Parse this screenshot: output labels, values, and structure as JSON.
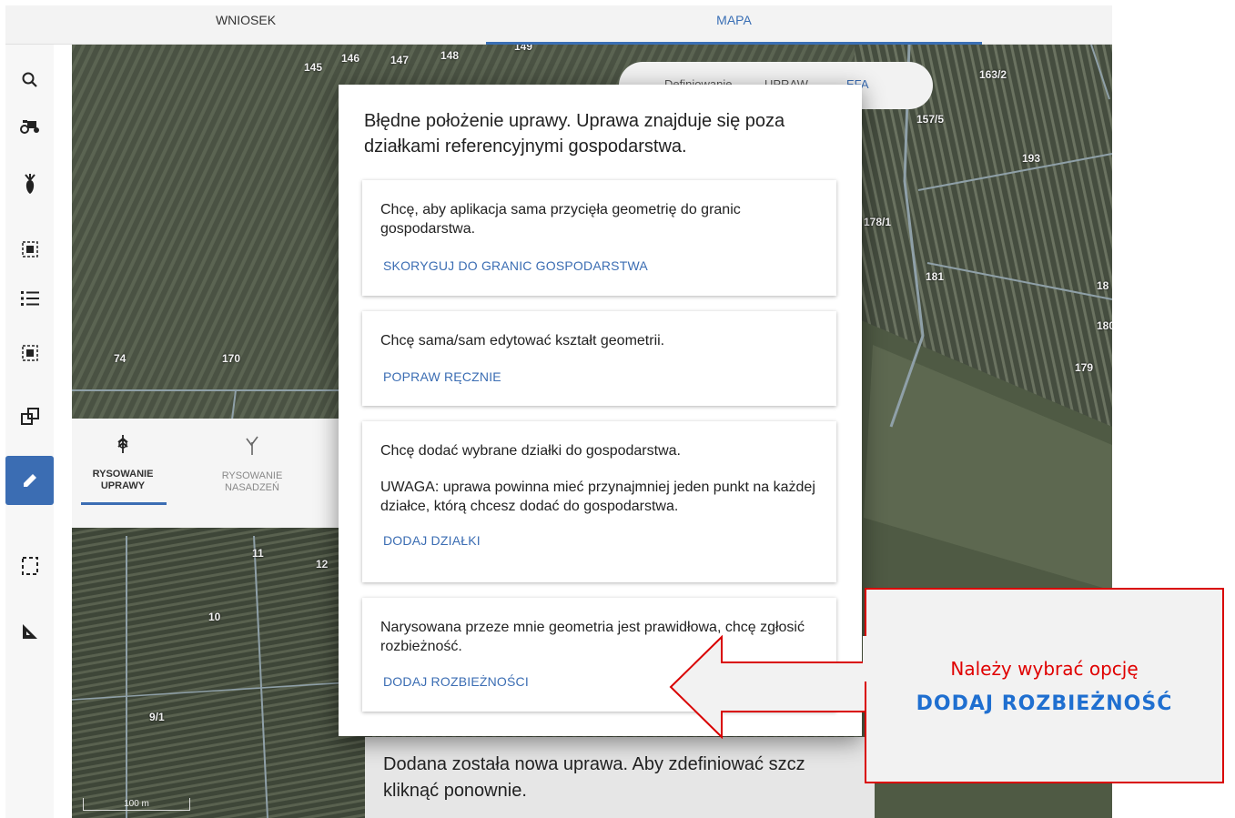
{
  "tabs": [
    {
      "label": "WNIOSEK"
    },
    {
      "label": "MAPA"
    }
  ],
  "toolbar_icons": [
    "search-icon",
    "tractor-icon",
    "plant-icon",
    "select-area-icon",
    "list-icon",
    "select-area-icon",
    "layers-icon",
    "edit-icon",
    "bounding-box-icon",
    "ruler-triangle-icon"
  ],
  "parcel_labels": [
    "145",
    "146",
    "147",
    "148",
    "149",
    "163/2",
    "157/5",
    "193",
    "178/1",
    "181",
    "18",
    "180",
    "179",
    "74",
    "170",
    "11",
    "12",
    "10",
    "9/1"
  ],
  "scale": "100 m",
  "pill": {
    "a": "Definiowanie",
    "b": "UPRAW",
    "c": "EFA"
  },
  "drawing": {
    "crop_label_1": "RYSOWANIE",
    "crop_label_2": "UPRAWY",
    "planting_label_1": "RYSOWANIE",
    "planting_label_2": "NASADZEŃ"
  },
  "modal": {
    "title": "Błędne położenie uprawy. Uprawa znajduje się poza działkami referencyjnymi gospodarstwa.",
    "options": [
      {
        "text": "Chcę, aby aplikacja sama przycięła geometrię do granic gospodarstwa.",
        "link": "SKORYGUJ DO GRANIC GOSPODARSTWA"
      },
      {
        "text": "Chcę sama/sam edytować kształt geometrii.",
        "link": "POPRAW RĘCZNIE"
      },
      {
        "text": "Chcę dodać wybrane działki do gospodarstwa.",
        "note": "UWAGA: uprawa powinna mieć przynajmniej jeden punkt na każdej działce, którą chcesz dodać do gospodarstwa.",
        "link": "DODAJ DZIAŁKI"
      },
      {
        "text": "Narysowana przeze mnie geometria jest prawidłowa, chcę zgłosić rozbieżność.",
        "link": "DODAJ ROZBIEŻNOŚCI"
      }
    ]
  },
  "toast": {
    "text": "Dodana została nowa uprawa. Aby zdefiniować szcz kliknąć ponownie."
  },
  "callout": {
    "line1": "Należy wybrać opcję",
    "line2": "DODAJ ROZBIEŻNOŚĆ"
  },
  "colors": {
    "accent": "#3b6db3",
    "callout_red": "#e00000",
    "callout_blue": "#1f6fd0"
  }
}
